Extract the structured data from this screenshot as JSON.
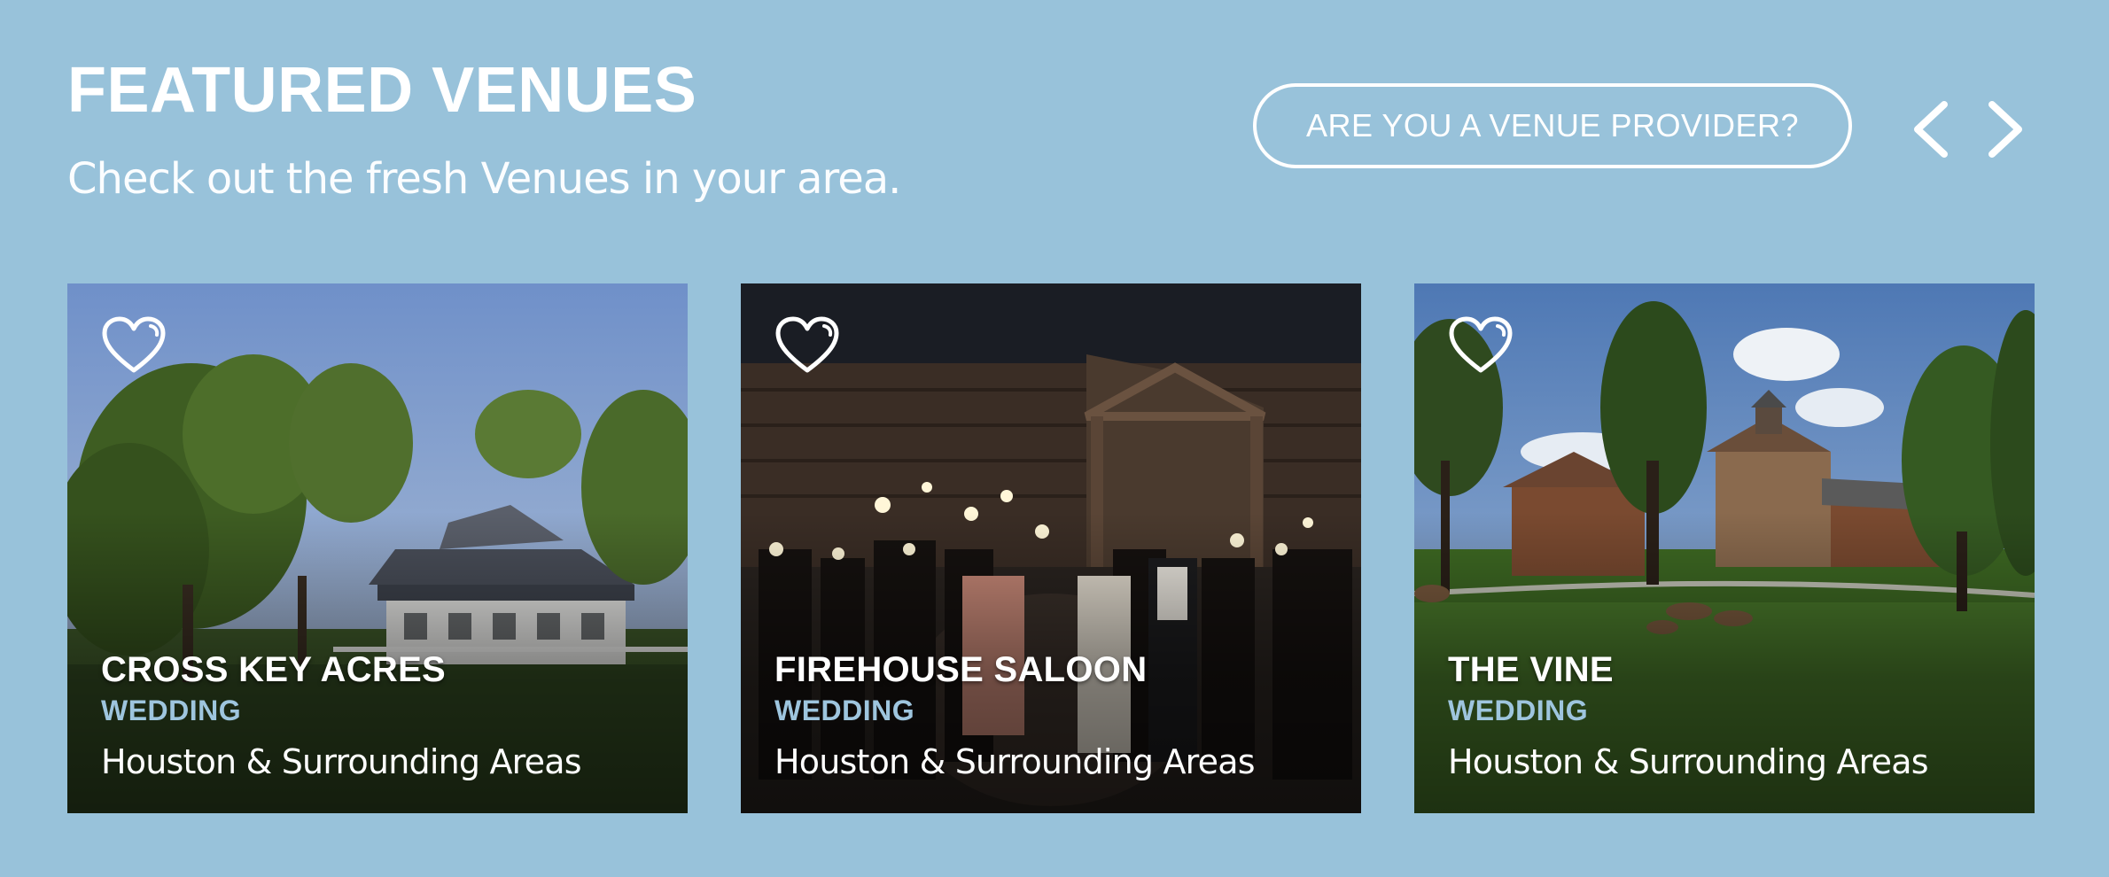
{
  "header": {
    "title": "FEATURED VENUES",
    "subtitle": "Check out the fresh Venues in your area.",
    "provider_button": "ARE YOU A VENUE PROVIDER?"
  },
  "navigation": {
    "prev_icon": "chevron-left-icon",
    "next_icon": "chevron-right-icon"
  },
  "colors": {
    "background": "#98c2da",
    "category_accent": "#9ec5de",
    "text": "#ffffff"
  },
  "venues": [
    {
      "name": "CROSS KEY ACRES",
      "category": "WEDDING",
      "location": "Houston & Surrounding Areas",
      "icon": "heart-icon"
    },
    {
      "name": "FIREHOUSE SALOON",
      "category": "WEDDING",
      "location": "Houston & Surrounding Areas",
      "icon": "heart-icon"
    },
    {
      "name": "THE VINE",
      "category": "WEDDING",
      "location": "Houston & Surrounding Areas",
      "icon": "heart-icon"
    }
  ]
}
